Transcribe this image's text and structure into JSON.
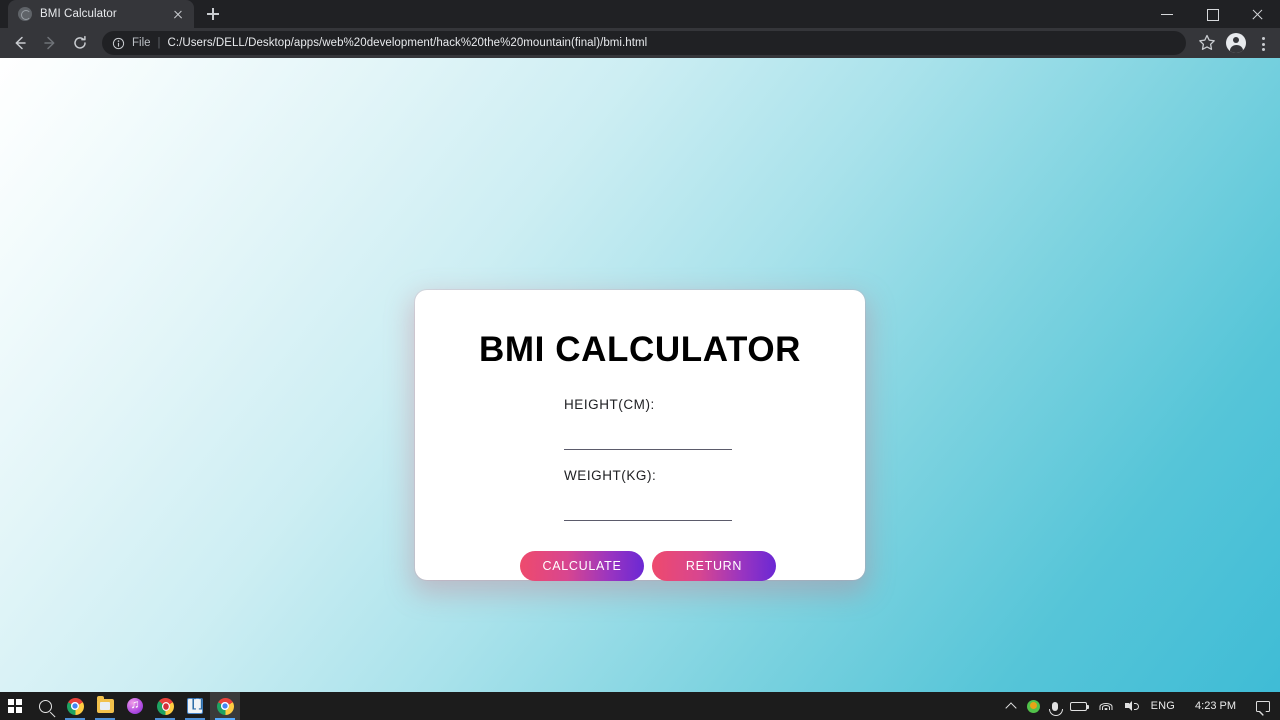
{
  "browser": {
    "tab": {
      "title": "BMI Calculator",
      "favicon": "globe-icon",
      "close": "close-tab-icon"
    },
    "new_tab_label": "+",
    "window_controls": {
      "minimize": "minimize-icon",
      "maximize": "maximize-icon",
      "close": "close-window-icon"
    },
    "toolbar": {
      "back": "back-arrow-icon",
      "forward": "forward-arrow-icon",
      "reload": "reload-icon",
      "site_info": "info-circle-icon",
      "url_scheme": "File",
      "url_separator": "|",
      "url": "C:/Users/DELL/Desktop/apps/web%20development/hack%20the%20mountain(final)/bmi.html",
      "bookmark": "star-icon",
      "profile": "profile-avatar-icon",
      "menu": "three-dot-menu-icon"
    }
  },
  "page": {
    "title": "BMI CALCULATOR",
    "fields": [
      {
        "label": "HEIGHT(CM):",
        "value": "",
        "placeholder": ""
      },
      {
        "label": "WEIGHT(KG):",
        "value": "",
        "placeholder": ""
      }
    ],
    "buttons": {
      "calculate": "CALCULATE",
      "return": "RETURN"
    },
    "colors": {
      "background_start": "#ffffff",
      "background_end": "#3fbcd6",
      "card_background": "#ffffff",
      "button_gradient_start": "#ee4a6d",
      "button_gradient_end": "#6b28d4",
      "card_shadow": "#c8788c"
    }
  },
  "taskbar": {
    "start": "windows-logo-icon",
    "search": "search-icon",
    "apps": [
      {
        "name": "chrome-icon"
      },
      {
        "name": "file-explorer-icon"
      },
      {
        "name": "itunes-icon"
      },
      {
        "name": "opera-icon"
      },
      {
        "name": "brackets-editor-icon"
      },
      {
        "name": "chrome-active-icon"
      }
    ],
    "tray": {
      "show_hidden": "chevron-up-icon",
      "update": "update-icon",
      "microphone": "microphone-icon",
      "battery": "battery-icon",
      "network": "wifi-icon",
      "volume": "speaker-icon",
      "language": "ENG",
      "clock": "4:23 PM",
      "action_center": "notification-icon"
    }
  }
}
